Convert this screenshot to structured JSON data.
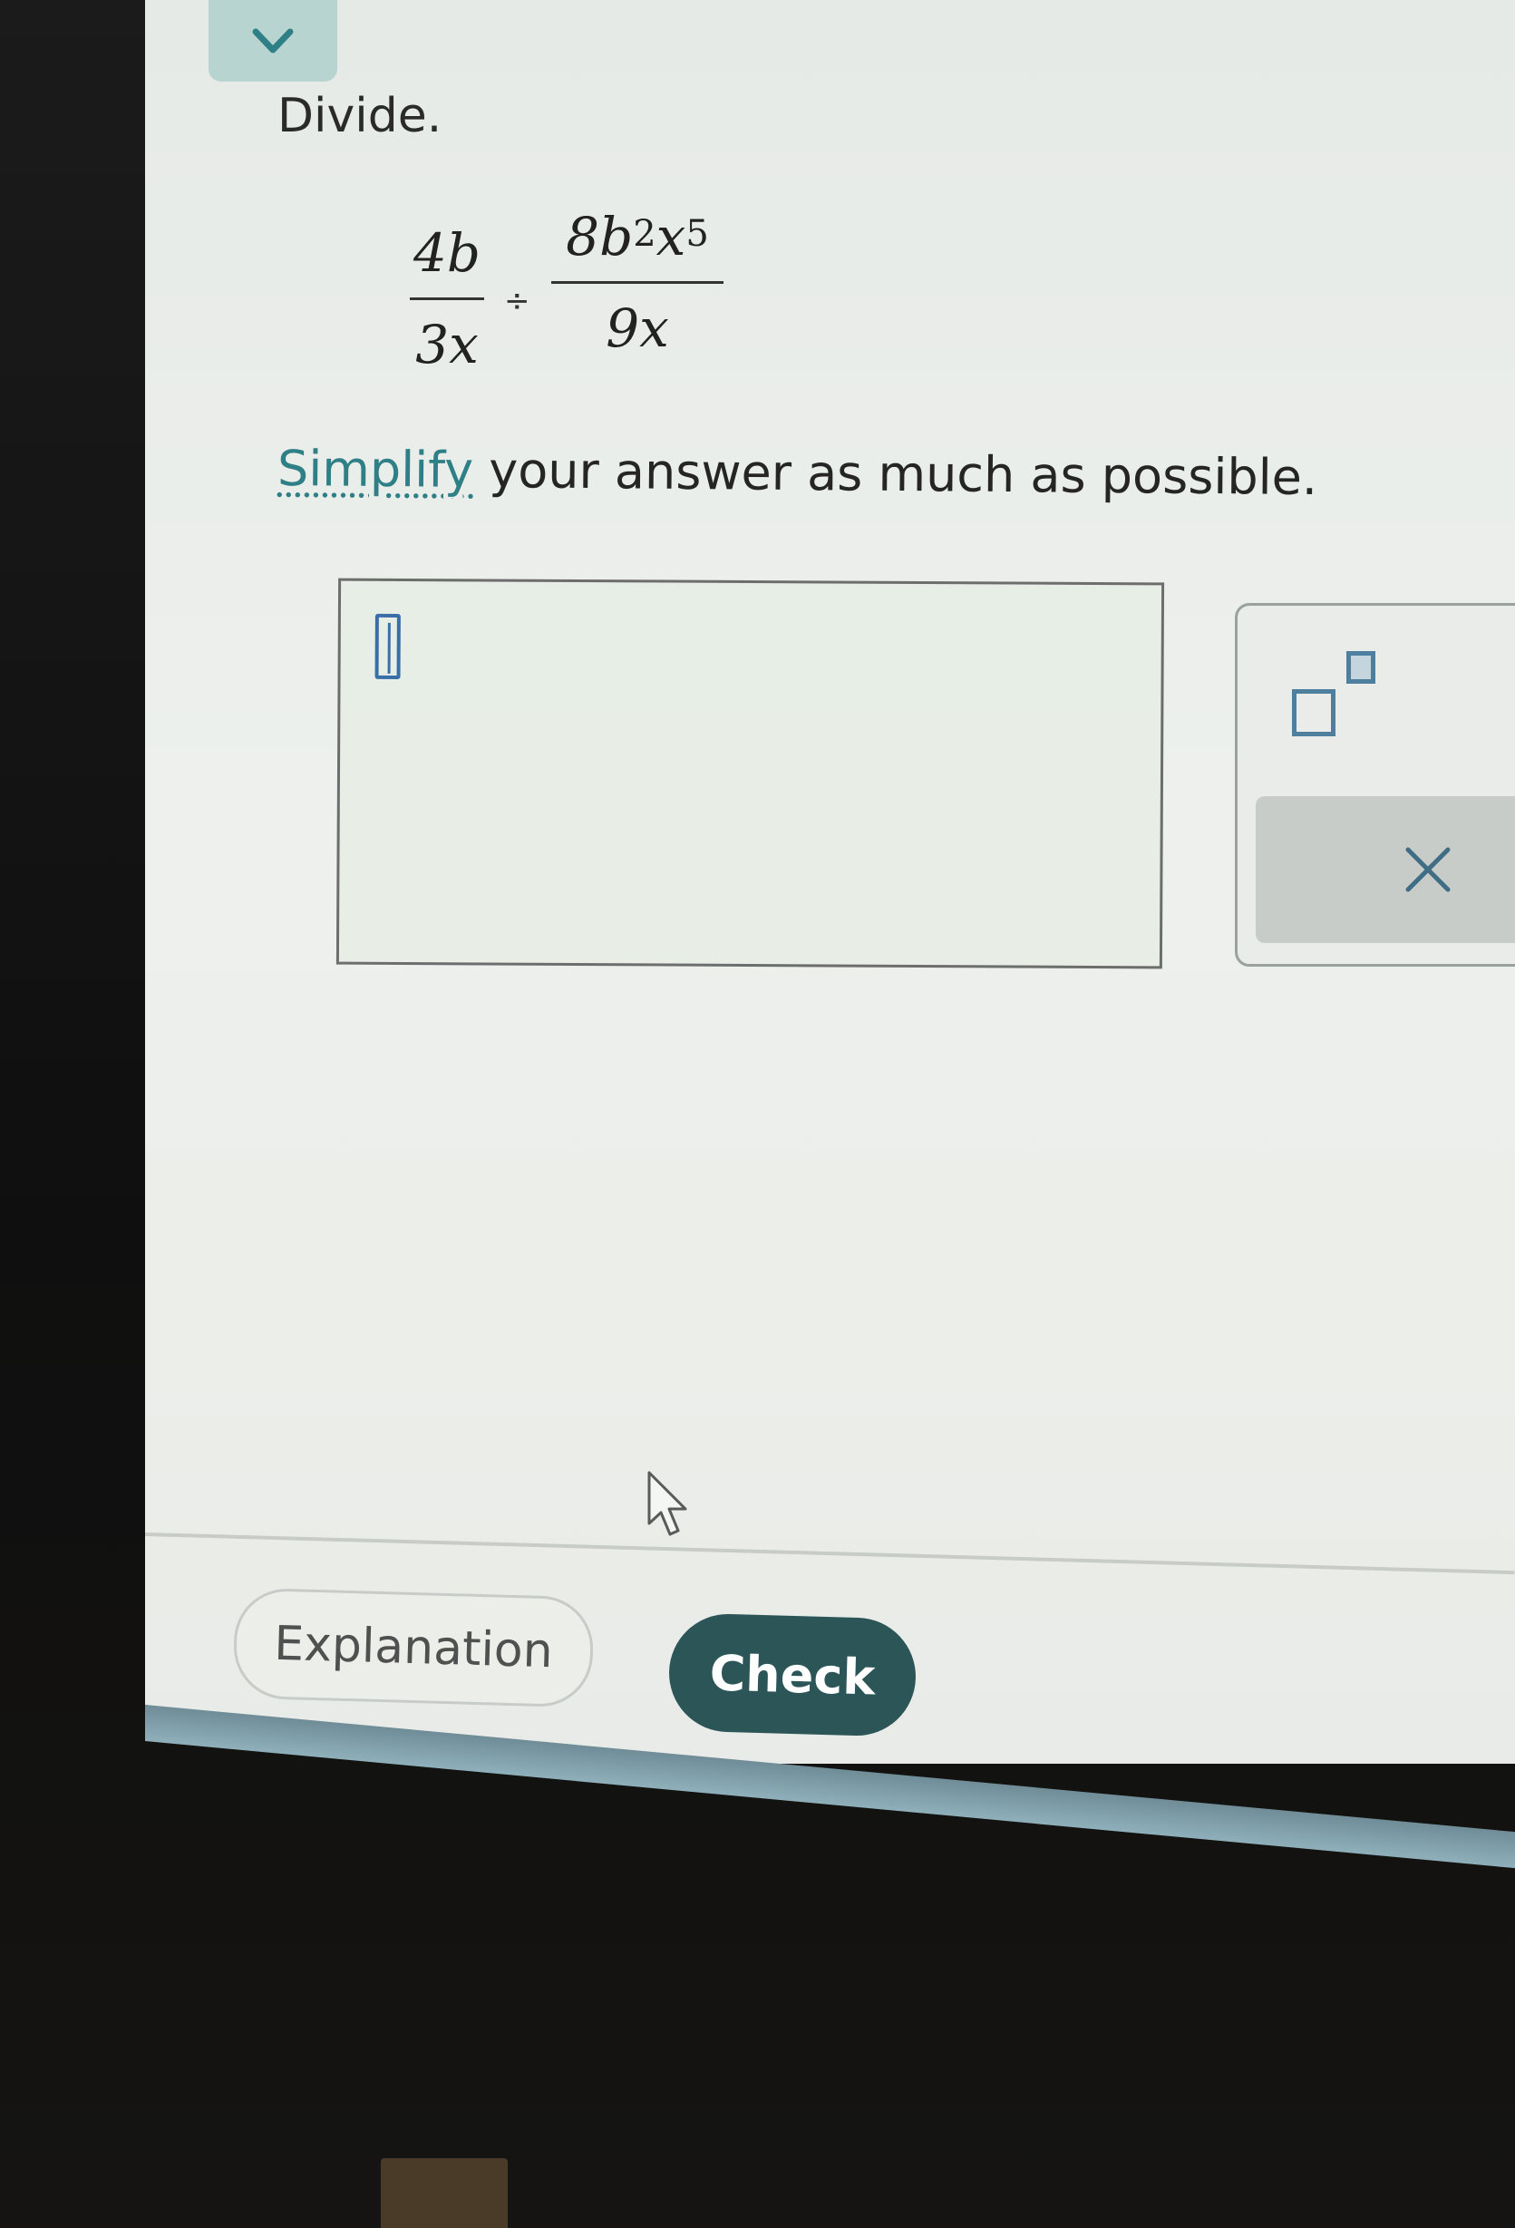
{
  "header": {
    "collapse_icon": "chevron-down-icon"
  },
  "question": {
    "instruction_label": "Divide.",
    "expression": {
      "left": {
        "numerator": "4b",
        "denominator": "3x"
      },
      "operator": "÷",
      "right": {
        "numerator_coeff": "8b",
        "numerator_exp1": "2",
        "numerator_var": "x",
        "numerator_exp2": "5",
        "denominator": "9x"
      }
    },
    "simplify_link": "Simplify",
    "simplify_rest": " your answer as much as possible."
  },
  "answer": {
    "value": ""
  },
  "palette": {
    "superscript_icon": "superscript-icon",
    "clear_icon": "close-icon",
    "clear_label": "×"
  },
  "footer": {
    "explanation_label": "Explanation",
    "check_label": "Check"
  },
  "colors": {
    "accent": "#2f7f86",
    "check_button": "#2c5558",
    "collapse_tab": "#b8d4d0"
  }
}
